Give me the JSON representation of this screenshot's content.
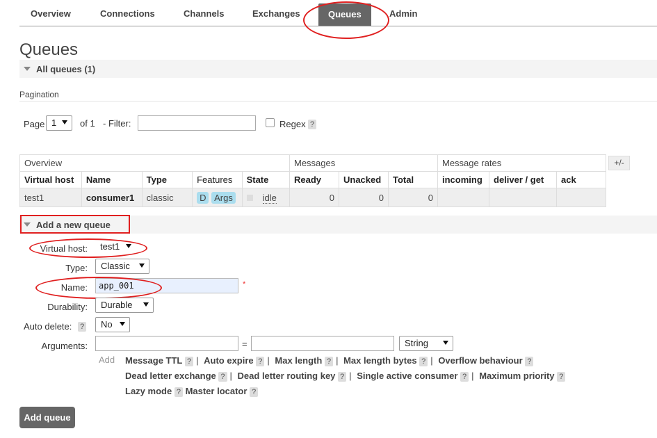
{
  "tabs": [
    {
      "label": "Overview"
    },
    {
      "label": "Connections"
    },
    {
      "label": "Channels"
    },
    {
      "label": "Exchanges"
    },
    {
      "label": "Queues",
      "active": true
    },
    {
      "label": "Admin"
    }
  ],
  "page_title": "Queues",
  "all_queues": "All queues (1)",
  "pagination": {
    "label": "Pagination",
    "page_label": "Page",
    "page_value": "1",
    "of_label": "of 1",
    "filter_label": "- Filter:",
    "filter_value": "",
    "regex_label": "Regex",
    "help": "?"
  },
  "table": {
    "groups": [
      "Overview",
      "Messages",
      "Message rates"
    ],
    "toggle": "+/-",
    "columns": [
      "Virtual host",
      "Name",
      "Type",
      "Features",
      "State",
      "Ready",
      "Unacked",
      "Total",
      "incoming",
      "deliver / get",
      "ack"
    ],
    "rows": [
      {
        "vhost": "test1",
        "name": "consumer1",
        "type": "classic",
        "features": [
          "D",
          "Args"
        ],
        "state": "idle",
        "ready": "0",
        "unacked": "0",
        "total": "0",
        "incoming": "",
        "deliver_get": "",
        "ack": ""
      }
    ]
  },
  "add_queue": {
    "title": "Add a new queue",
    "labels": {
      "virtual_host": "Virtual host:",
      "type": "Type:",
      "name": "Name:",
      "durability": "Durability:",
      "auto_delete": "Auto delete:",
      "arguments": "Arguments:"
    },
    "values": {
      "virtual_host": "test1",
      "type": "Classic",
      "name": "app_001",
      "durability": "Durable",
      "auto_delete": "No",
      "arg_key": "",
      "arg_value": "",
      "arg_type": "String"
    },
    "required_mark": "*",
    "eq": "=",
    "add_label": "Add",
    "arg_links": [
      [
        "Message TTL",
        "Auto expire",
        "Max length",
        "Max length bytes",
        "Overflow behaviour"
      ],
      [
        "Dead letter exchange",
        "Dead letter routing key",
        "Single active consumer",
        "Maximum priority"
      ],
      [
        "Lazy mode",
        "Master locator"
      ]
    ],
    "help": "?",
    "sep": "|",
    "submit": "Add queue"
  },
  "colors": {
    "accent": "#666666",
    "annotation": "#e02020",
    "badge": "#aaddee"
  }
}
